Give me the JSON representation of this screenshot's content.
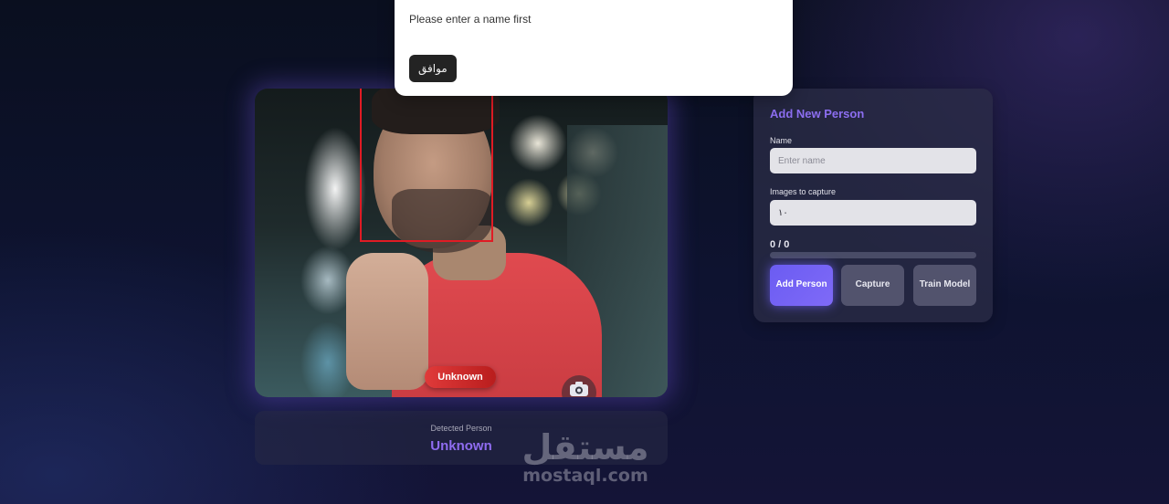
{
  "alert": {
    "message": "Please enter a name first",
    "ok_label": "موافق"
  },
  "camera": {
    "detection_label": "Unknown",
    "box_color": "#e01b24",
    "switch_icon": "camera-switch-icon"
  },
  "detected": {
    "label": "Detected Person",
    "name": "Unknown"
  },
  "panel": {
    "title": "Add New Person",
    "name_label": "Name",
    "name_placeholder": "Enter name",
    "name_value": "",
    "images_label": "Images to capture",
    "images_value": "١٠",
    "progress_text": "0 / 0",
    "progress_fraction": 0,
    "buttons": {
      "add": "Add Person",
      "capture": "Capture",
      "train": "Train Model"
    }
  },
  "colors": {
    "accent": "#8c6ef0",
    "button_primary": "#6b5cf2",
    "badge_red": "#e03a3a"
  },
  "watermark": {
    "arabic": "مستقل",
    "latin": "mostaql.com"
  }
}
